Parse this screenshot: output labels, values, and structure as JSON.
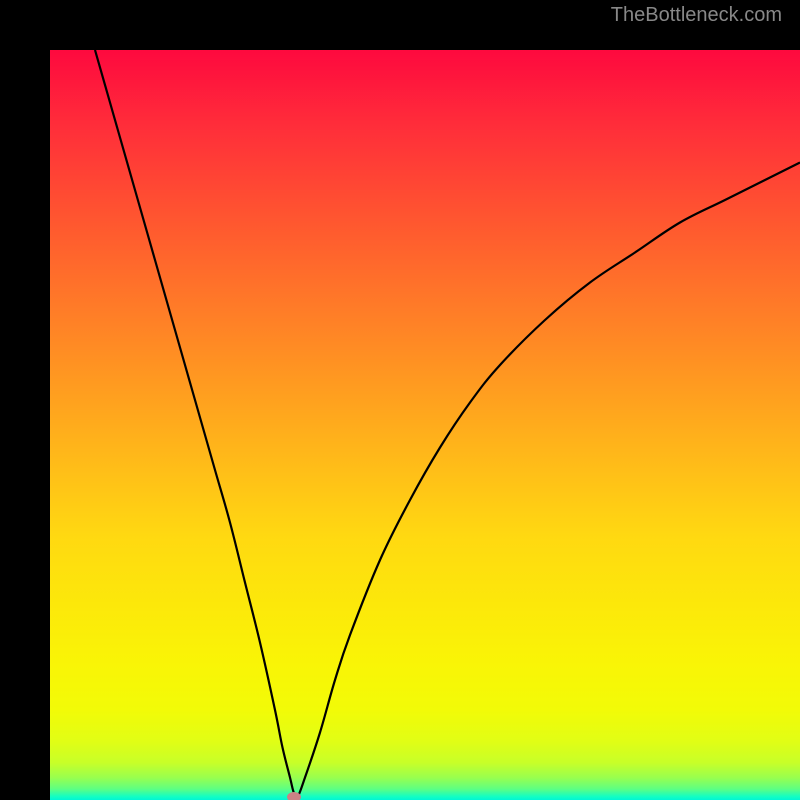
{
  "watermark": "TheBottleneck.com",
  "chart_data": {
    "type": "line",
    "title": "",
    "xlabel": "",
    "ylabel": "",
    "xlim": [
      0,
      100
    ],
    "ylim": [
      0,
      100
    ],
    "grid": false,
    "legend": false,
    "series": [
      {
        "name": "bottleneck-curve",
        "x": [
          6,
          8,
          10,
          12,
          14,
          16,
          18,
          20,
          22,
          24,
          26,
          28,
          30,
          31,
          32,
          32.5,
          33,
          34,
          36,
          38,
          40,
          44,
          48,
          52,
          56,
          60,
          66,
          72,
          78,
          84,
          90,
          96,
          100
        ],
        "values": [
          100,
          93,
          86,
          79,
          72,
          65,
          58,
          51,
          44,
          37,
          29,
          21,
          12,
          7,
          3,
          1,
          0.4,
          3,
          9,
          16,
          22,
          32,
          40,
          47,
          53,
          58,
          64,
          69,
          73,
          77,
          80,
          83,
          85
        ]
      }
    ],
    "annotations": [
      {
        "name": "optimal-point",
        "x": 32.5,
        "y": 0.4
      }
    ],
    "background_gradient": {
      "top": "#fe093e",
      "bottom": "#00f6d6",
      "stops": [
        "#fe093e",
        "#ff5430",
        "#ff9f1f",
        "#ffd911",
        "#f9f506",
        "#c8ff28",
        "#16fec0"
      ]
    }
  }
}
